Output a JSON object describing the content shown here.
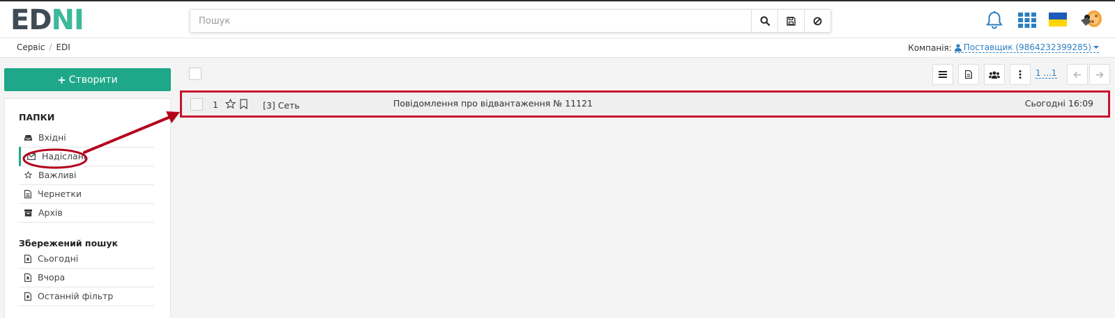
{
  "header": {
    "logo_left": "ED",
    "logo_right": "NI",
    "search_placeholder": "Пошук",
    "icons": [
      "search-icon",
      "save-icon",
      "clear-icon",
      "bell-icon",
      "apps-grid-icon",
      "ukraine-flag-icon",
      "user-avatar-icon"
    ],
    "colors": {
      "brand_green": "#3cb89b",
      "brand_dark": "#404a54",
      "accent_green": "#1ea789",
      "link_blue": "#2d7fc1",
      "highlight_red": "#c8102e"
    }
  },
  "breadcrumb": {
    "items": [
      "Сервіс",
      "EDI"
    ],
    "separator": "/"
  },
  "company": {
    "label": "Компанія:",
    "value": "Поставщик (9864232399285)"
  },
  "sidebar": {
    "create_label": "Створити",
    "folders_title": "ПАПКИ",
    "folders": [
      {
        "label": "Вхідні",
        "icon": "inbox-icon"
      },
      {
        "label": "Надіслані",
        "icon": "envelope-icon",
        "active": true
      },
      {
        "label": "Важливі",
        "icon": "star-icon"
      },
      {
        "label": "Чернетки",
        "icon": "draft-icon"
      },
      {
        "label": "Архів",
        "icon": "archive-icon"
      }
    ],
    "saved_title": "Збережений пошук",
    "saved": [
      {
        "label": "Сьогодні",
        "icon": "saved-file-icon"
      },
      {
        "label": "Вчора",
        "icon": "saved-file-icon"
      },
      {
        "label": "Останній фільтр",
        "icon": "saved-file-icon"
      }
    ]
  },
  "toolbar": {
    "icons": [
      "list-view-icon",
      "document-icon",
      "group-icon",
      "more-vertical-icon",
      "arrow-left-icon",
      "arrow-right-icon"
    ],
    "pagination": "1 ...1"
  },
  "messages": [
    {
      "number": "1",
      "sender": "[3] Сеть",
      "subject": "Повідомлення про відвантаження № 11121",
      "date": "Сьогодні 16:09"
    }
  ]
}
